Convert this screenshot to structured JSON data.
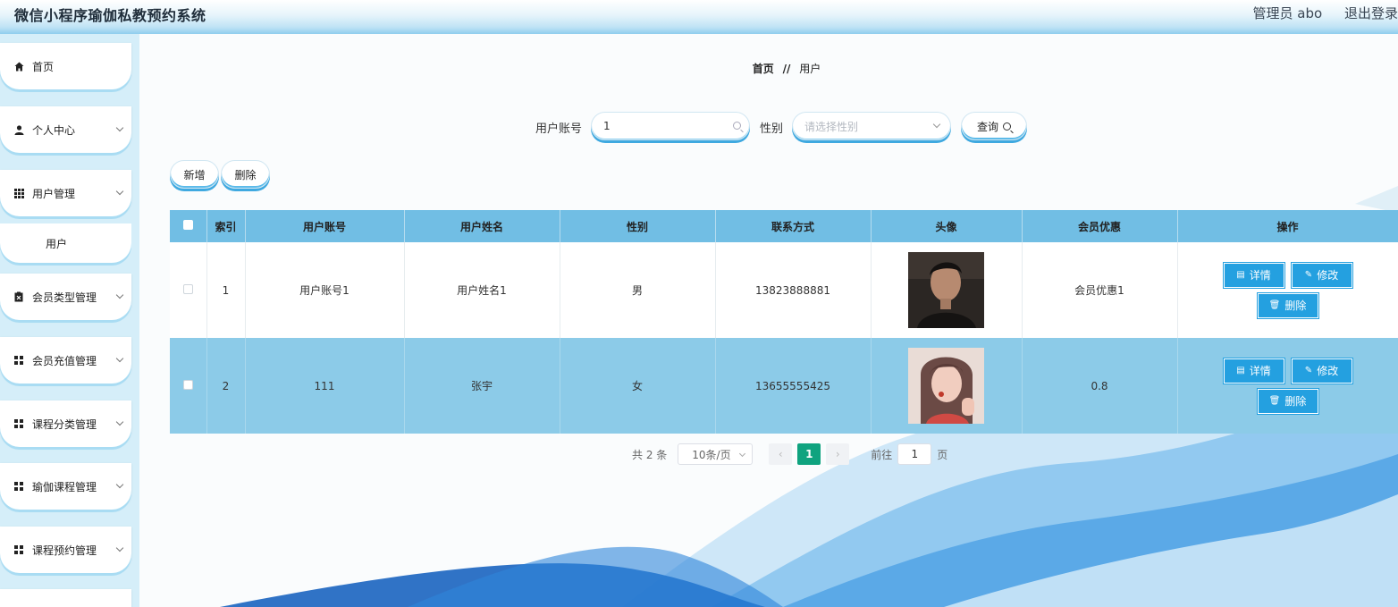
{
  "app": {
    "title": "微信小程序瑜伽私教预约系统"
  },
  "header": {
    "user_label": "管理员 abo",
    "logout": "退出登录"
  },
  "sidebar": {
    "items": [
      {
        "label": "首页",
        "icon": "home-icon"
      },
      {
        "label": "个人中心",
        "icon": "person-icon"
      },
      {
        "label": "用户管理",
        "icon": "grid-icon"
      },
      {
        "label": "用户",
        "icon": ""
      },
      {
        "label": "会员类型管理",
        "icon": "clipboard-icon"
      },
      {
        "label": "会员充值管理",
        "icon": "apps-icon"
      },
      {
        "label": "课程分类管理",
        "icon": "apps-icon"
      },
      {
        "label": "瑜伽课程管理",
        "icon": "apps-icon"
      },
      {
        "label": "课程预约管理",
        "icon": "apps-icon"
      }
    ]
  },
  "breadcrumb": {
    "home": "首页",
    "sep": "//",
    "current": "用户"
  },
  "search": {
    "account_label": "用户账号",
    "account_value": "1",
    "gender_label": "性别",
    "gender_placeholder": "请选择性别",
    "query_button": "查询"
  },
  "actions": {
    "add": "新增",
    "delete": "删除"
  },
  "table": {
    "headers": [
      "索引",
      "用户账号",
      "用户姓名",
      "性别",
      "联系方式",
      "头像",
      "会员优惠",
      "操作"
    ],
    "rows": [
      {
        "index": "1",
        "account": "用户账号1",
        "name": "用户姓名1",
        "gender": "男",
        "phone": "13823888881",
        "discount": "会员优惠1"
      },
      {
        "index": "2",
        "account": "111",
        "name": "张宇",
        "gender": "女",
        "phone": "13655555425",
        "discount": "0.8"
      }
    ],
    "op_detail": "详情",
    "op_edit": "修改",
    "op_delete": "删除"
  },
  "pagination": {
    "total": "共 2 条",
    "page_size": "10条/页",
    "current_page": "1",
    "goto_prefix": "前往",
    "goto_value": "1",
    "goto_suffix": "页"
  },
  "colors": {
    "header_bg": "#71bee4",
    "selected_row": "#8ccbe8",
    "button": "#24a0e0",
    "pager_active": "#0fa37f"
  }
}
